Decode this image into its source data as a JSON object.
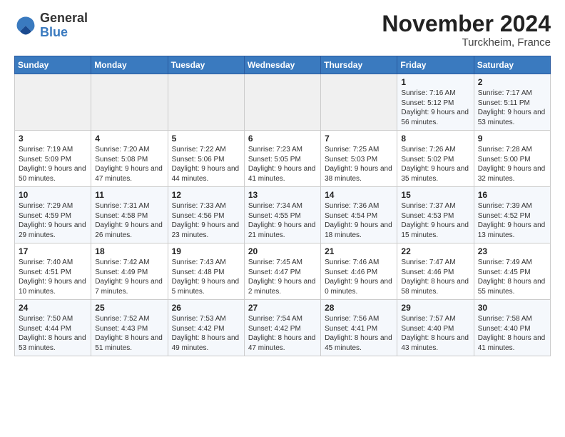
{
  "logo": {
    "general": "General",
    "blue": "Blue"
  },
  "header": {
    "month_title": "November 2024",
    "location": "Turckheim, France"
  },
  "weekdays": [
    "Sunday",
    "Monday",
    "Tuesday",
    "Wednesday",
    "Thursday",
    "Friday",
    "Saturday"
  ],
  "weeks": [
    [
      {
        "day": "",
        "info": ""
      },
      {
        "day": "",
        "info": ""
      },
      {
        "day": "",
        "info": ""
      },
      {
        "day": "",
        "info": ""
      },
      {
        "day": "",
        "info": ""
      },
      {
        "day": "1",
        "info": "Sunrise: 7:16 AM\nSunset: 5:12 PM\nDaylight: 9 hours and 56 minutes."
      },
      {
        "day": "2",
        "info": "Sunrise: 7:17 AM\nSunset: 5:11 PM\nDaylight: 9 hours and 53 minutes."
      }
    ],
    [
      {
        "day": "3",
        "info": "Sunrise: 7:19 AM\nSunset: 5:09 PM\nDaylight: 9 hours and 50 minutes."
      },
      {
        "day": "4",
        "info": "Sunrise: 7:20 AM\nSunset: 5:08 PM\nDaylight: 9 hours and 47 minutes."
      },
      {
        "day": "5",
        "info": "Sunrise: 7:22 AM\nSunset: 5:06 PM\nDaylight: 9 hours and 44 minutes."
      },
      {
        "day": "6",
        "info": "Sunrise: 7:23 AM\nSunset: 5:05 PM\nDaylight: 9 hours and 41 minutes."
      },
      {
        "day": "7",
        "info": "Sunrise: 7:25 AM\nSunset: 5:03 PM\nDaylight: 9 hours and 38 minutes."
      },
      {
        "day": "8",
        "info": "Sunrise: 7:26 AM\nSunset: 5:02 PM\nDaylight: 9 hours and 35 minutes."
      },
      {
        "day": "9",
        "info": "Sunrise: 7:28 AM\nSunset: 5:00 PM\nDaylight: 9 hours and 32 minutes."
      }
    ],
    [
      {
        "day": "10",
        "info": "Sunrise: 7:29 AM\nSunset: 4:59 PM\nDaylight: 9 hours and 29 minutes."
      },
      {
        "day": "11",
        "info": "Sunrise: 7:31 AM\nSunset: 4:58 PM\nDaylight: 9 hours and 26 minutes."
      },
      {
        "day": "12",
        "info": "Sunrise: 7:33 AM\nSunset: 4:56 PM\nDaylight: 9 hours and 23 minutes."
      },
      {
        "day": "13",
        "info": "Sunrise: 7:34 AM\nSunset: 4:55 PM\nDaylight: 9 hours and 21 minutes."
      },
      {
        "day": "14",
        "info": "Sunrise: 7:36 AM\nSunset: 4:54 PM\nDaylight: 9 hours and 18 minutes."
      },
      {
        "day": "15",
        "info": "Sunrise: 7:37 AM\nSunset: 4:53 PM\nDaylight: 9 hours and 15 minutes."
      },
      {
        "day": "16",
        "info": "Sunrise: 7:39 AM\nSunset: 4:52 PM\nDaylight: 9 hours and 13 minutes."
      }
    ],
    [
      {
        "day": "17",
        "info": "Sunrise: 7:40 AM\nSunset: 4:51 PM\nDaylight: 9 hours and 10 minutes."
      },
      {
        "day": "18",
        "info": "Sunrise: 7:42 AM\nSunset: 4:49 PM\nDaylight: 9 hours and 7 minutes."
      },
      {
        "day": "19",
        "info": "Sunrise: 7:43 AM\nSunset: 4:48 PM\nDaylight: 9 hours and 5 minutes."
      },
      {
        "day": "20",
        "info": "Sunrise: 7:45 AM\nSunset: 4:47 PM\nDaylight: 9 hours and 2 minutes."
      },
      {
        "day": "21",
        "info": "Sunrise: 7:46 AM\nSunset: 4:46 PM\nDaylight: 9 hours and 0 minutes."
      },
      {
        "day": "22",
        "info": "Sunrise: 7:47 AM\nSunset: 4:46 PM\nDaylight: 8 hours and 58 minutes."
      },
      {
        "day": "23",
        "info": "Sunrise: 7:49 AM\nSunset: 4:45 PM\nDaylight: 8 hours and 55 minutes."
      }
    ],
    [
      {
        "day": "24",
        "info": "Sunrise: 7:50 AM\nSunset: 4:44 PM\nDaylight: 8 hours and 53 minutes."
      },
      {
        "day": "25",
        "info": "Sunrise: 7:52 AM\nSunset: 4:43 PM\nDaylight: 8 hours and 51 minutes."
      },
      {
        "day": "26",
        "info": "Sunrise: 7:53 AM\nSunset: 4:42 PM\nDaylight: 8 hours and 49 minutes."
      },
      {
        "day": "27",
        "info": "Sunrise: 7:54 AM\nSunset: 4:42 PM\nDaylight: 8 hours and 47 minutes."
      },
      {
        "day": "28",
        "info": "Sunrise: 7:56 AM\nSunset: 4:41 PM\nDaylight: 8 hours and 45 minutes."
      },
      {
        "day": "29",
        "info": "Sunrise: 7:57 AM\nSunset: 4:40 PM\nDaylight: 8 hours and 43 minutes."
      },
      {
        "day": "30",
        "info": "Sunrise: 7:58 AM\nSunset: 4:40 PM\nDaylight: 8 hours and 41 minutes."
      }
    ]
  ]
}
